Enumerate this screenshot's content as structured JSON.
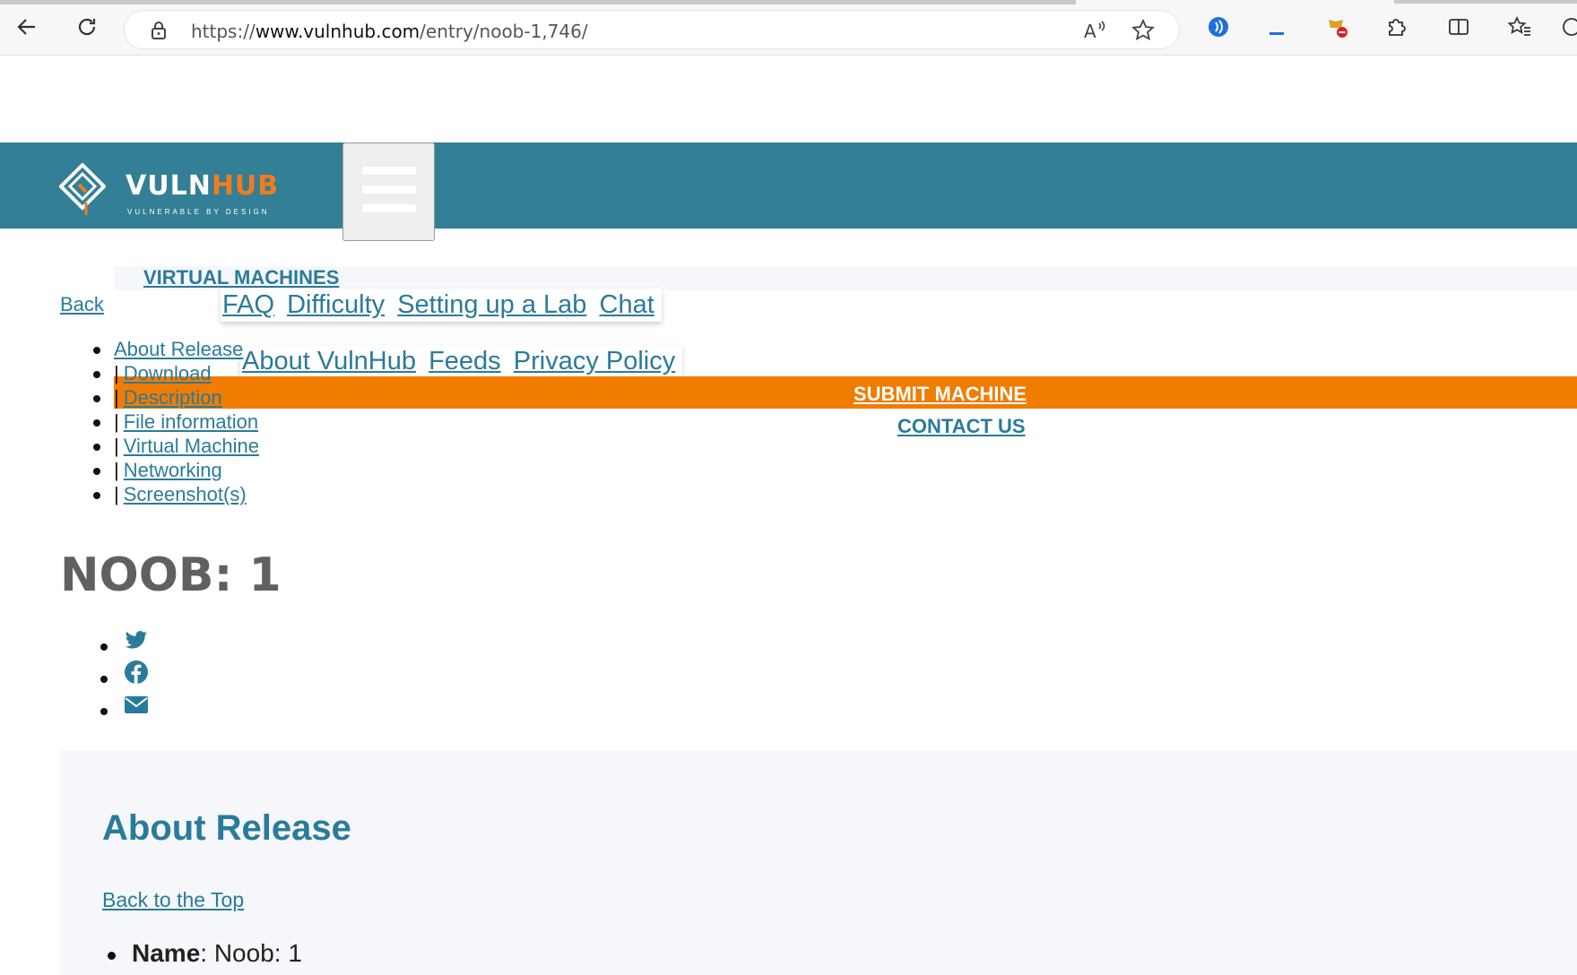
{
  "browser": {
    "url_prefix": "https://",
    "url_host": "www.vulnhub.com",
    "url_path": "/entry/noob-1,746/",
    "icons": [
      "back-arrow-icon",
      "refresh-icon",
      "lock-icon",
      "read-aloud-icon",
      "favorite-star-icon",
      "extension-icons",
      "split-screen-icon",
      "favorites-icon"
    ]
  },
  "header": {
    "logo_word_main": "VULN",
    "logo_word_accent": "HUB",
    "logo_tagline": "VULNERABLE BY DESIGN",
    "brand_color": "#337f96",
    "accent_color": "#f07c00"
  },
  "nav": {
    "virtual_machines": "VIRTUAL MACHINES",
    "back": "Back",
    "row1": [
      "FAQ",
      "Difficulty",
      "Setting up a Lab",
      "Chat"
    ],
    "row2": [
      "About VulnHub",
      "Feeds",
      "Privacy Policy"
    ],
    "submit_machine": "SUBMIT MACHINE",
    "contact_us": "CONTACT US"
  },
  "toc": {
    "pipe": "|",
    "items": [
      "About Release",
      "Download",
      "Description",
      "File information",
      "Virtual Machine",
      "Networking",
      "Screenshot(s)"
    ]
  },
  "page_title": "NOOB: 1",
  "social": [
    "twitter-icon",
    "facebook-icon",
    "email-icon"
  ],
  "about_release": {
    "heading": "About Release",
    "back_to_top": "Back to the Top",
    "name_label": "Name",
    "name_value": ": Noob: 1"
  }
}
